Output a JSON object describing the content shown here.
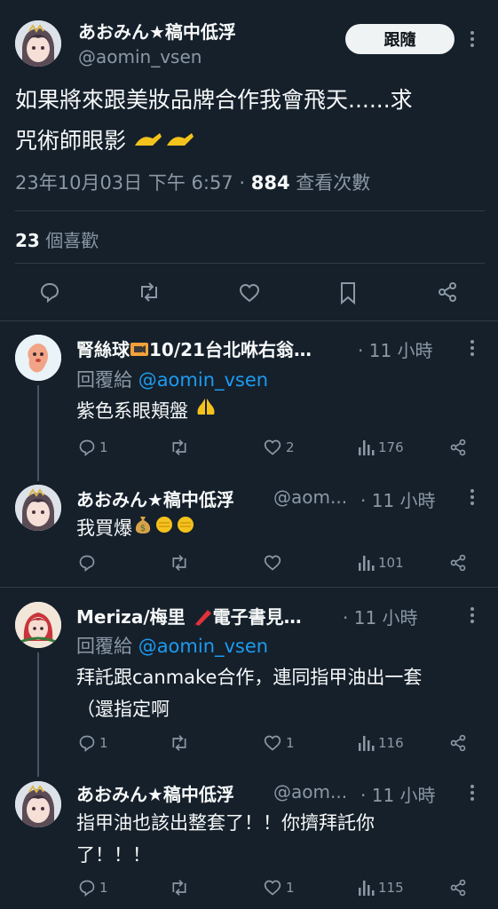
{
  "main_tweet": {
    "display_name": "あおみん★稿中低浮",
    "handle": "@aomin_vsen",
    "follow_label": "跟隨",
    "text": "如果將來跟美妝品牌合作我會飛天......求咒術師眼影",
    "text_line1": "如果將來跟美妝品牌合作我會飛天......求",
    "text_line2": "咒術師眼影",
    "timestamp": "23年10月03日 下午 6:57",
    "dot": "·",
    "views_count": "884",
    "views_label": "查看次數",
    "likes_count": "23",
    "likes_label": "個喜歡"
  },
  "replies": [
    {
      "display_name": "腎絲球🎦10/21台北咻右翁…",
      "name_text": "腎絲球",
      "name_text_2": "10/21台北咻右翁…",
      "time": "· 11 小時",
      "reply_to_label": "回覆給",
      "reply_to_handle": "@aomin_vsen",
      "text": "紫色系眼頬盤",
      "replies_count": "1",
      "retweets_count": "",
      "likes_count": "2",
      "views_count": "176"
    },
    {
      "display_name": "あおみん★稿中低浮",
      "handle": "@aom...",
      "time": "· 11 小時",
      "text": "我買爆",
      "replies_count": "",
      "retweets_count": "",
      "likes_count": "",
      "views_count": "101"
    },
    {
      "display_name": "Meriza/梅里 🖍電子書見…",
      "name_text": "Meriza/梅里",
      "name_text_2": "電子書見…",
      "time": "· 11 小時",
      "reply_to_label": "回覆給",
      "reply_to_handle": "@aomin_vsen",
      "text_line1": "拜託跟canmake合作，連同指甲油出一套",
      "text_line2": "（還指定啊",
      "replies_count": "1",
      "retweets_count": "",
      "likes_count": "1",
      "views_count": "116"
    },
    {
      "display_name": "あおみん★稿中低浮",
      "handle": "@aom...",
      "time": "· 11 小時",
      "text_line1": "指甲油也該出整套了！！你擠拜託你",
      "text_line2": "了！！！",
      "replies_count": "1",
      "retweets_count": "",
      "likes_count": "1",
      "views_count": "115"
    }
  ],
  "colors": {
    "background": "#15202b",
    "text": "#f7f9f9",
    "muted": "#8b98a5",
    "link": "#1d9bf0",
    "divider": "#2f3b47"
  },
  "icons": [
    "more-icon",
    "reply-icon",
    "retweet-icon",
    "like-icon",
    "bookmark-icon",
    "share-icon",
    "views-icon"
  ]
}
